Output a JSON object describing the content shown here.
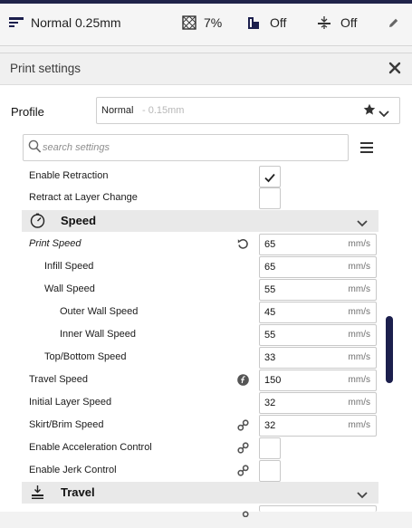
{
  "topbar": {
    "profile_label": "Normal 0.25mm",
    "infill_value": "7%",
    "support_value": "Off",
    "adhesion_value": "Off"
  },
  "panel": {
    "title": "Print settings",
    "profile_label": "Profile",
    "profile_name": "Normal",
    "profile_sub": "- 0.15mm",
    "search_placeholder": "search settings"
  },
  "settings": {
    "enable_retraction": "Enable Retraction",
    "retract_layer_change": "Retract at Layer Change",
    "speed_category": "Speed",
    "print_speed": {
      "label": "Print Speed",
      "value": "65",
      "unit": "mm/s"
    },
    "infill_speed": {
      "label": "Infill Speed",
      "value": "65",
      "unit": "mm/s"
    },
    "wall_speed": {
      "label": "Wall Speed",
      "value": "55",
      "unit": "mm/s"
    },
    "outer_wall_speed": {
      "label": "Outer Wall Speed",
      "value": "45",
      "unit": "mm/s"
    },
    "inner_wall_speed": {
      "label": "Inner Wall Speed",
      "value": "55",
      "unit": "mm/s"
    },
    "top_bottom_speed": {
      "label": "Top/Bottom Speed",
      "value": "33",
      "unit": "mm/s"
    },
    "travel_speed": {
      "label": "Travel Speed",
      "value": "150",
      "unit": "mm/s"
    },
    "initial_layer_speed": {
      "label": "Initial Layer Speed",
      "value": "32",
      "unit": "mm/s"
    },
    "skirt_brim_speed": {
      "label": "Skirt/Brim Speed",
      "value": "32",
      "unit": "mm/s"
    },
    "enable_accel": "Enable Acceleration Control",
    "enable_jerk": "Enable Jerk Control",
    "travel_category": "Travel"
  },
  "colors": {
    "accent": "#20234a",
    "scrollbar": "#1c1f4d"
  }
}
